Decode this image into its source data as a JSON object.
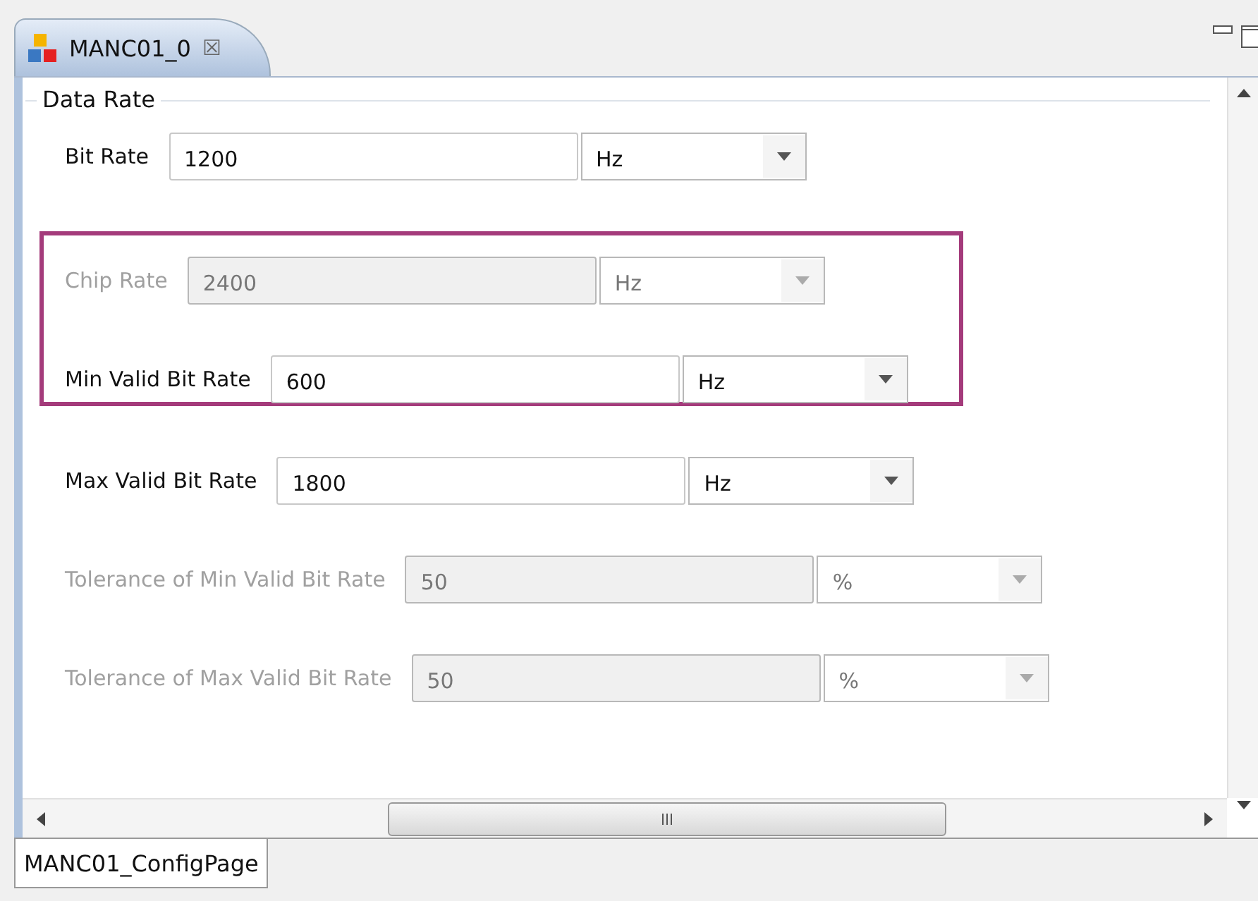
{
  "editor_tab": {
    "title": "MANC01_0",
    "close": "☒"
  },
  "group": {
    "title": "Data Rate"
  },
  "field_groups": [
    {
      "highlighted": false,
      "fields": [
        {
          "label": "Bit Rate",
          "value": "1200",
          "unit": "Hz",
          "disabled": false
        }
      ]
    },
    {
      "highlighted": true,
      "fields": [
        {
          "label": "Chip Rate",
          "value": "2400",
          "unit": "Hz",
          "disabled": true
        },
        {
          "label": "Min Valid Bit Rate",
          "value": "600",
          "unit": "Hz",
          "disabled": false
        }
      ]
    },
    {
      "highlighted": false,
      "fields": [
        {
          "label": "Max Valid Bit Rate",
          "value": "1800",
          "unit": "Hz",
          "disabled": false
        },
        {
          "label": "Tolerance of Min Valid Bit Rate",
          "value": "50",
          "unit": "%",
          "disabled": true
        },
        {
          "label": "Tolerance of Max Valid Bit Rate",
          "value": "50",
          "unit": "%",
          "disabled": true
        }
      ]
    }
  ],
  "page_tabs": [
    {
      "label": "MANC01_ConfigPage",
      "selected": true
    }
  ]
}
